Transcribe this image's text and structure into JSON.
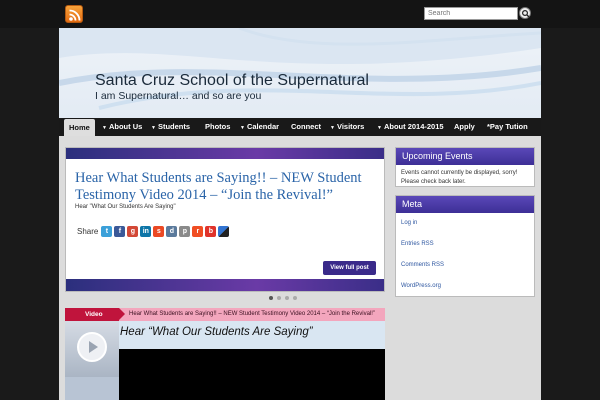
{
  "topbar": {
    "rss_icon": "rss-icon",
    "search_placeholder": "Search",
    "search_button_icon": "search-icon"
  },
  "header": {
    "site_title": "Santa Cruz School of the Supernatural",
    "tagline": "I am Supernatural… and so are you"
  },
  "nav": {
    "items": [
      {
        "label": "Home",
        "active": true,
        "dropdown": false
      },
      {
        "label": "About Us",
        "dropdown": true
      },
      {
        "label": "Students",
        "dropdown": true
      },
      {
        "label": "Photos",
        "dropdown": false
      },
      {
        "label": "Calendar",
        "dropdown": true
      },
      {
        "label": "Connect",
        "dropdown": false
      },
      {
        "label": "Visitors",
        "dropdown": true
      },
      {
        "label": "About 2014-2015",
        "dropdown": true
      },
      {
        "label": "Apply",
        "dropdown": false
      },
      {
        "label": "*Pay Tution",
        "dropdown": false
      }
    ]
  },
  "slider": {
    "title": "Hear What Students are Saying!! – NEW Student Testimony Video 2014 – “Join the Revival!”",
    "subtitle": "Hear \"What Our Students Are Saying\"",
    "share_label": "Share",
    "share_icons": [
      "twitter-icon",
      "facebook-icon",
      "google-plus-icon",
      "linkedin-icon",
      "stumbleupon-icon",
      "digg-icon",
      "print-icon",
      "reddit-icon",
      "blogger-icon",
      "delicious-icon"
    ],
    "view_post_label": "View full post",
    "dots": [
      true,
      false,
      false,
      false
    ]
  },
  "video": {
    "tag": "Video",
    "bar_text": "Hear What Students are Saying!! – NEW Student Testimony Video 2014 – “Join the Revival!”",
    "player_title": "Hear “What Our Students Are Saying”"
  },
  "sidebar": {
    "upcoming_events": {
      "title": "Upcoming Events",
      "body": "Events cannot currently be displayed, sorry! Please check back later."
    },
    "meta": {
      "title": "Meta",
      "links": [
        "Log in",
        "Entries RSS",
        "Comments RSS",
        "WordPress.org"
      ]
    }
  },
  "colors": {
    "accent_purple": "#3d2f96",
    "link_blue": "#2a64a8",
    "video_red": "#c0143c",
    "video_pink": "#f3a6bd"
  }
}
